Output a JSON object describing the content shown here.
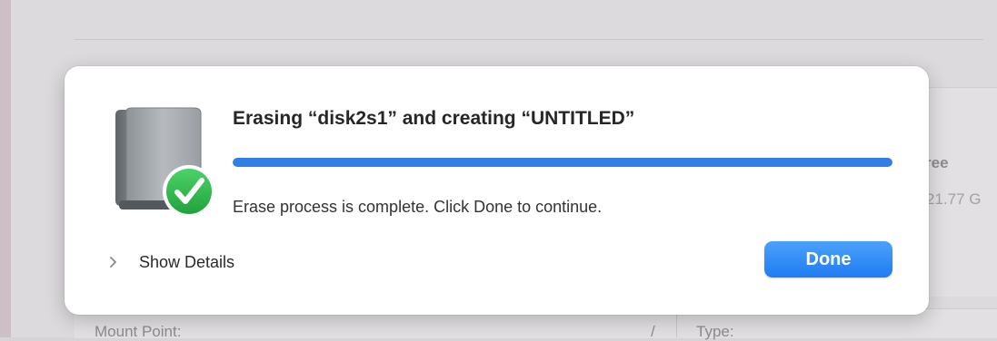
{
  "background": {
    "free_label": "ree",
    "free_value": "21.77 G",
    "mount_point_label": "Mount Point:",
    "mount_point_value": "/",
    "type_label": "Type:"
  },
  "dialog": {
    "title": "Erasing “disk2s1” and creating “UNTITLED”",
    "progress_percent": 100,
    "status": "Erase process is complete. Click Done to continue.",
    "show_details_label": "Show Details",
    "done_label": "Done",
    "icon": "external-disk-with-checkmark",
    "chevron_icon": "chevron-right"
  },
  "colors": {
    "accent": "#2f7fe6",
    "success": "#2fb34a",
    "button": "#1f7cf2"
  }
}
